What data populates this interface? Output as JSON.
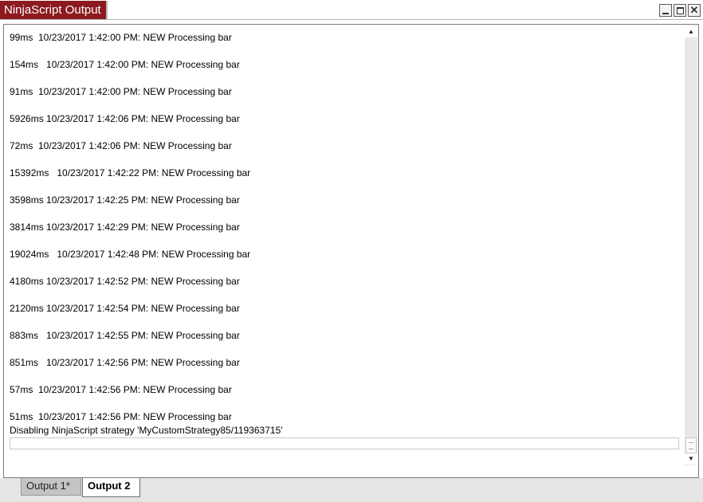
{
  "window": {
    "title": "NinjaScript Output",
    "controls": [
      "minimize-icon",
      "maximize-icon",
      "close-icon"
    ],
    "close_glyph": "✕",
    "accent_color": "#8c1a1e"
  },
  "output": {
    "lines": [
      "99ms  10/23/2017 1:42:00 PM: NEW Processing bar",
      "154ms   10/23/2017 1:42:00 PM: NEW Processing bar",
      "91ms  10/23/2017 1:42:00 PM: NEW Processing bar",
      "5926ms 10/23/2017 1:42:06 PM: NEW Processing bar",
      "72ms  10/23/2017 1:42:06 PM: NEW Processing bar",
      "15392ms   10/23/2017 1:42:22 PM: NEW Processing bar",
      "3598ms 10/23/2017 1:42:25 PM: NEW Processing bar",
      "3814ms 10/23/2017 1:42:29 PM: NEW Processing bar",
      "19024ms   10/23/2017 1:42:48 PM: NEW Processing bar",
      "4180ms 10/23/2017 1:42:52 PM: NEW Processing bar",
      "2120ms 10/23/2017 1:42:54 PM: NEW Processing bar",
      "883ms   10/23/2017 1:42:55 PM: NEW Processing bar",
      "851ms   10/23/2017 1:42:56 PM: NEW Processing bar",
      "57ms  10/23/2017 1:42:56 PM: NEW Processing bar",
      "51ms  10/23/2017 1:42:56 PM: NEW Processing bar"
    ],
    "final_line": "Disabling NinjaScript strategy 'MyCustomStrategy85/119363715'",
    "input_value": ""
  },
  "scrollbar": {
    "up_glyph": "▲",
    "down_glyph": "▼"
  },
  "tabs": [
    {
      "label": "Output 1*",
      "active": false
    },
    {
      "label": "Output 2",
      "active": true
    }
  ]
}
